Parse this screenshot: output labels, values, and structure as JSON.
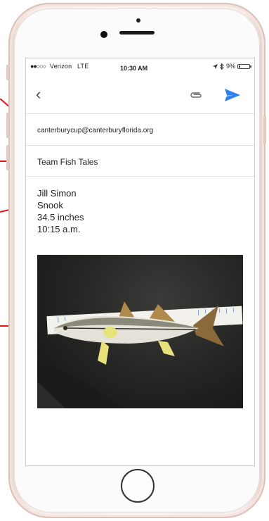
{
  "status_bar": {
    "signal_dots": "●●○○○",
    "carrier": "Verizon",
    "network": "LTE",
    "time": "10:30 AM",
    "battery": "9%"
  },
  "email": {
    "to": "canterburycup@canterburyflorida.org",
    "subject": "Team Fish Tales",
    "body_lines": [
      "Jill Simon",
      "Snook",
      "34.5 inches",
      "10:15 a.m."
    ],
    "photo_description_icon": "fish-photo"
  },
  "colors": {
    "accent": "#2f80ed",
    "annotation": "#e8141c",
    "phone_body": "#f6ebe8"
  }
}
